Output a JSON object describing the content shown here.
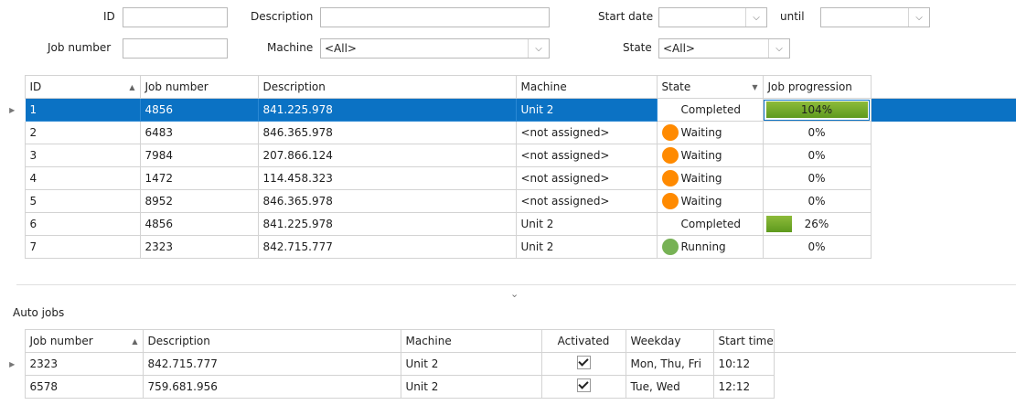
{
  "filters": {
    "id_label": "ID",
    "description_label": "Description",
    "start_date_label": "Start date",
    "until_label": "until",
    "job_number_label": "Job number",
    "machine_label": "Machine",
    "machine_value": "<All>",
    "state_label": "State",
    "state_value": "<All>"
  },
  "jobs": {
    "headers": {
      "id": "ID",
      "job_number": "Job number",
      "description": "Description",
      "machine": "Machine",
      "state": "State",
      "progression": "Job progression"
    },
    "rows": [
      {
        "id": "1",
        "job_number": "4856",
        "description": "841.225.978",
        "machine": "Unit 2",
        "state": "Completed",
        "state_dot": "",
        "progress": "104%",
        "progress_fill": 1.04
      },
      {
        "id": "2",
        "job_number": "6483",
        "description": "846.365.978",
        "machine": "<not assigned>",
        "state": "Waiting",
        "state_dot": "#ff8a00",
        "progress": "0%",
        "progress_fill": 0
      },
      {
        "id": "3",
        "job_number": "7984",
        "description": "207.866.124",
        "machine": "<not assigned>",
        "state": "Waiting",
        "state_dot": "#ff8a00",
        "progress": "0%",
        "progress_fill": 0
      },
      {
        "id": "4",
        "job_number": "1472",
        "description": "114.458.323",
        "machine": "<not assigned>",
        "state": "Waiting",
        "state_dot": "#ff8a00",
        "progress": "0%",
        "progress_fill": 0
      },
      {
        "id": "5",
        "job_number": "8952",
        "description": "846.365.978",
        "machine": "<not assigned>",
        "state": "Waiting",
        "state_dot": "#ff8a00",
        "progress": "0%",
        "progress_fill": 0
      },
      {
        "id": "6",
        "job_number": "4856",
        "description": "841.225.978",
        "machine": "Unit 2",
        "state": "Completed",
        "state_dot": "",
        "progress": "26%",
        "progress_fill": 0.26
      },
      {
        "id": "7",
        "job_number": "2323",
        "description": "842.715.777",
        "machine": "Unit 2",
        "state": "Running",
        "state_dot": "#77b255",
        "progress": "0%",
        "progress_fill": 0
      }
    ]
  },
  "auto_jobs": {
    "title": "Auto jobs",
    "headers": {
      "job_number": "Job number",
      "description": "Description",
      "machine": "Machine",
      "activated": "Activated",
      "weekday": "Weekday",
      "start_time": "Start time"
    },
    "rows": [
      {
        "job_number": "2323",
        "description": "842.715.777",
        "machine": "Unit 2",
        "activated": true,
        "weekday": "Mon, Thu, Fri",
        "start_time": "10:12"
      },
      {
        "job_number": "6578",
        "description": "759.681.956",
        "machine": "Unit 2",
        "activated": true,
        "weekday": "Tue, Wed",
        "start_time": "12:12"
      }
    ]
  }
}
